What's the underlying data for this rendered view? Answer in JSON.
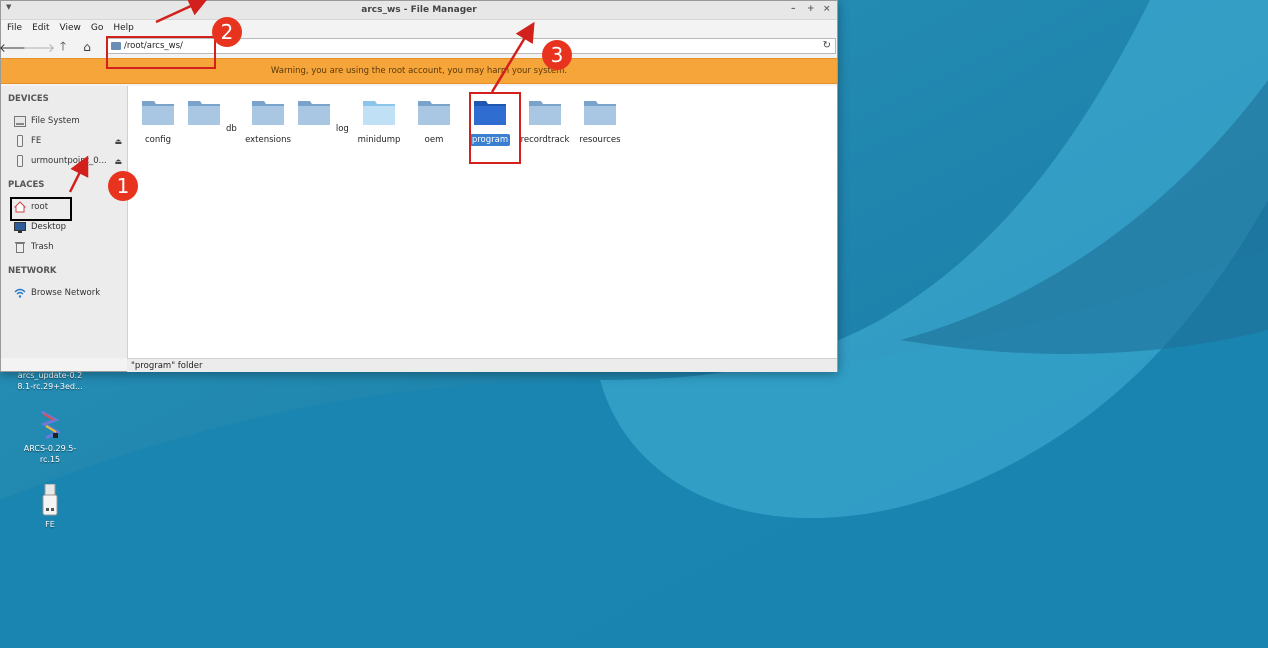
{
  "window": {
    "title": "arcs_ws - File Manager",
    "controls": [
      "–",
      "+",
      "×"
    ]
  },
  "menubar": [
    "File",
    "Edit",
    "View",
    "Go",
    "Help"
  ],
  "toolbar": {
    "path": "/root/arcs_ws/"
  },
  "warning": "Warning, you are using the root account, you may harm your system.",
  "sidebar": {
    "devices_heading": "DEVICES",
    "devices": [
      {
        "label": "File System",
        "icon": "drive-icon"
      },
      {
        "label": "FE",
        "icon": "usb-icon"
      },
      {
        "label": "urmountpoint_0...",
        "icon": "usb-icon"
      }
    ],
    "places_heading": "PLACES",
    "places": [
      {
        "label": "root",
        "icon": "home-icon"
      },
      {
        "label": "Desktop",
        "icon": "desktop-icon"
      },
      {
        "label": "Trash",
        "icon": "trash-icon"
      }
    ],
    "network_heading": "NETWORK",
    "network": [
      {
        "label": "Browse Network",
        "icon": "wifi-icon"
      }
    ]
  },
  "folders": [
    "config",
    "db",
    "extensions",
    "log",
    "minidump",
    "oem",
    "program",
    "recordtrack",
    "resources"
  ],
  "selected_folder": "program",
  "status": "\"program\" folder",
  "desktop_icons": [
    {
      "label": "arcs_update-0.2 8.1-rc.29+3ed..."
    },
    {
      "label": "ARCS-0.29.5- rc.15"
    },
    {
      "label": "FE"
    }
  ],
  "annotations": [
    "1",
    "2",
    "3"
  ],
  "colors": {
    "warning_bg": "#f6a53a",
    "selection": "#3a7fd0",
    "annotation_red": "#e8331f"
  }
}
